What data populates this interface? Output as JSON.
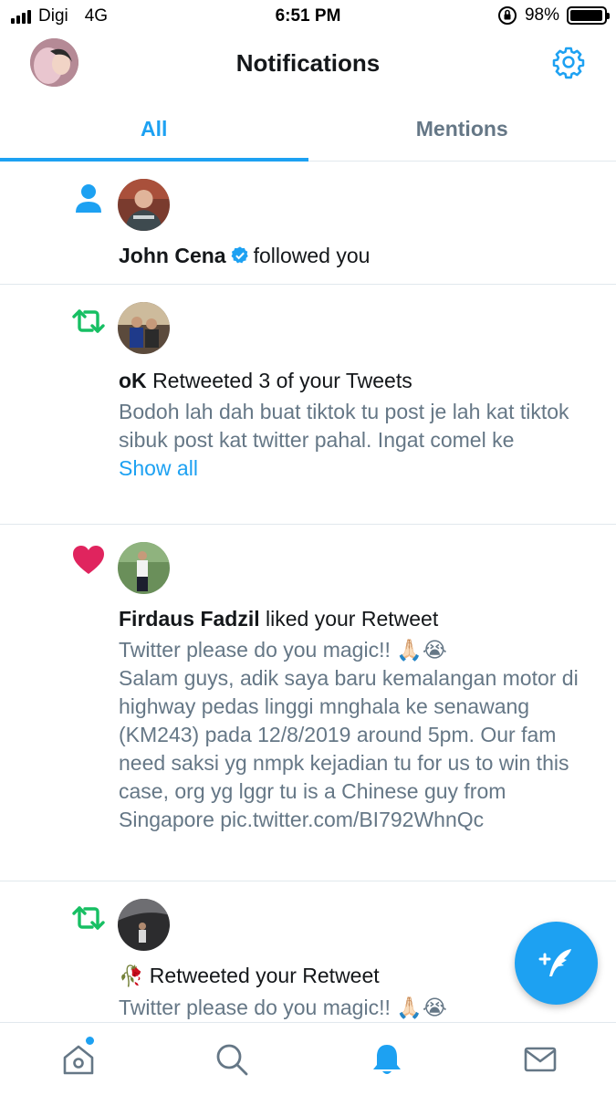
{
  "status_bar": {
    "carrier": "Digi",
    "network": "4G",
    "time": "6:51 PM",
    "battery": "98%",
    "battery_level": 0.98
  },
  "header": {
    "title": "Notifications",
    "settings_icon": "gear-icon"
  },
  "tabs": [
    {
      "label": "All",
      "active": true
    },
    {
      "label": "Mentions",
      "active": false
    }
  ],
  "notifications": [
    {
      "type": "follow",
      "icon": "person-icon",
      "actor": "John Cena",
      "verified": true,
      "action": "followed you"
    },
    {
      "type": "retweet",
      "icon": "retweet-icon",
      "actor": "oK",
      "action": "Retweeted 3 of your Tweets",
      "text": "Bodoh lah dah buat tiktok tu post je lah kat tiktok sibuk post kat twitter pahal. Ingat comel ke",
      "show_all": "Show all"
    },
    {
      "type": "like",
      "icon": "heart-icon",
      "actor": "Firdaus Fadzil",
      "action": "liked your Retweet",
      "text_line1": "Twitter please do you magic!! 🙏🏻😭",
      "text": "Salam guys, adik saya baru kemalangan motor di highway pedas linggi mnghala ke senawang (KM243) pada 12/8/2019 around 5pm. Our fam need saksi yg nmpk kejadian tu for us to win this case, org yg lggr tu is a Chinese guy from Singapore pic.twitter.com/BI792WhnQc"
    },
    {
      "type": "retweet",
      "icon": "retweet-icon",
      "actor": "🥀",
      "action": "Retweeted your Retweet",
      "text_line1": "Twitter please do you magic!! 🙏🏻😭"
    }
  ],
  "colors": {
    "accent": "#1da1f2",
    "retweet": "#17bf63",
    "like": "#e0245e",
    "muted": "#657786"
  },
  "bottom_nav": [
    "home-icon",
    "search-icon",
    "bell-icon",
    "mail-icon"
  ]
}
